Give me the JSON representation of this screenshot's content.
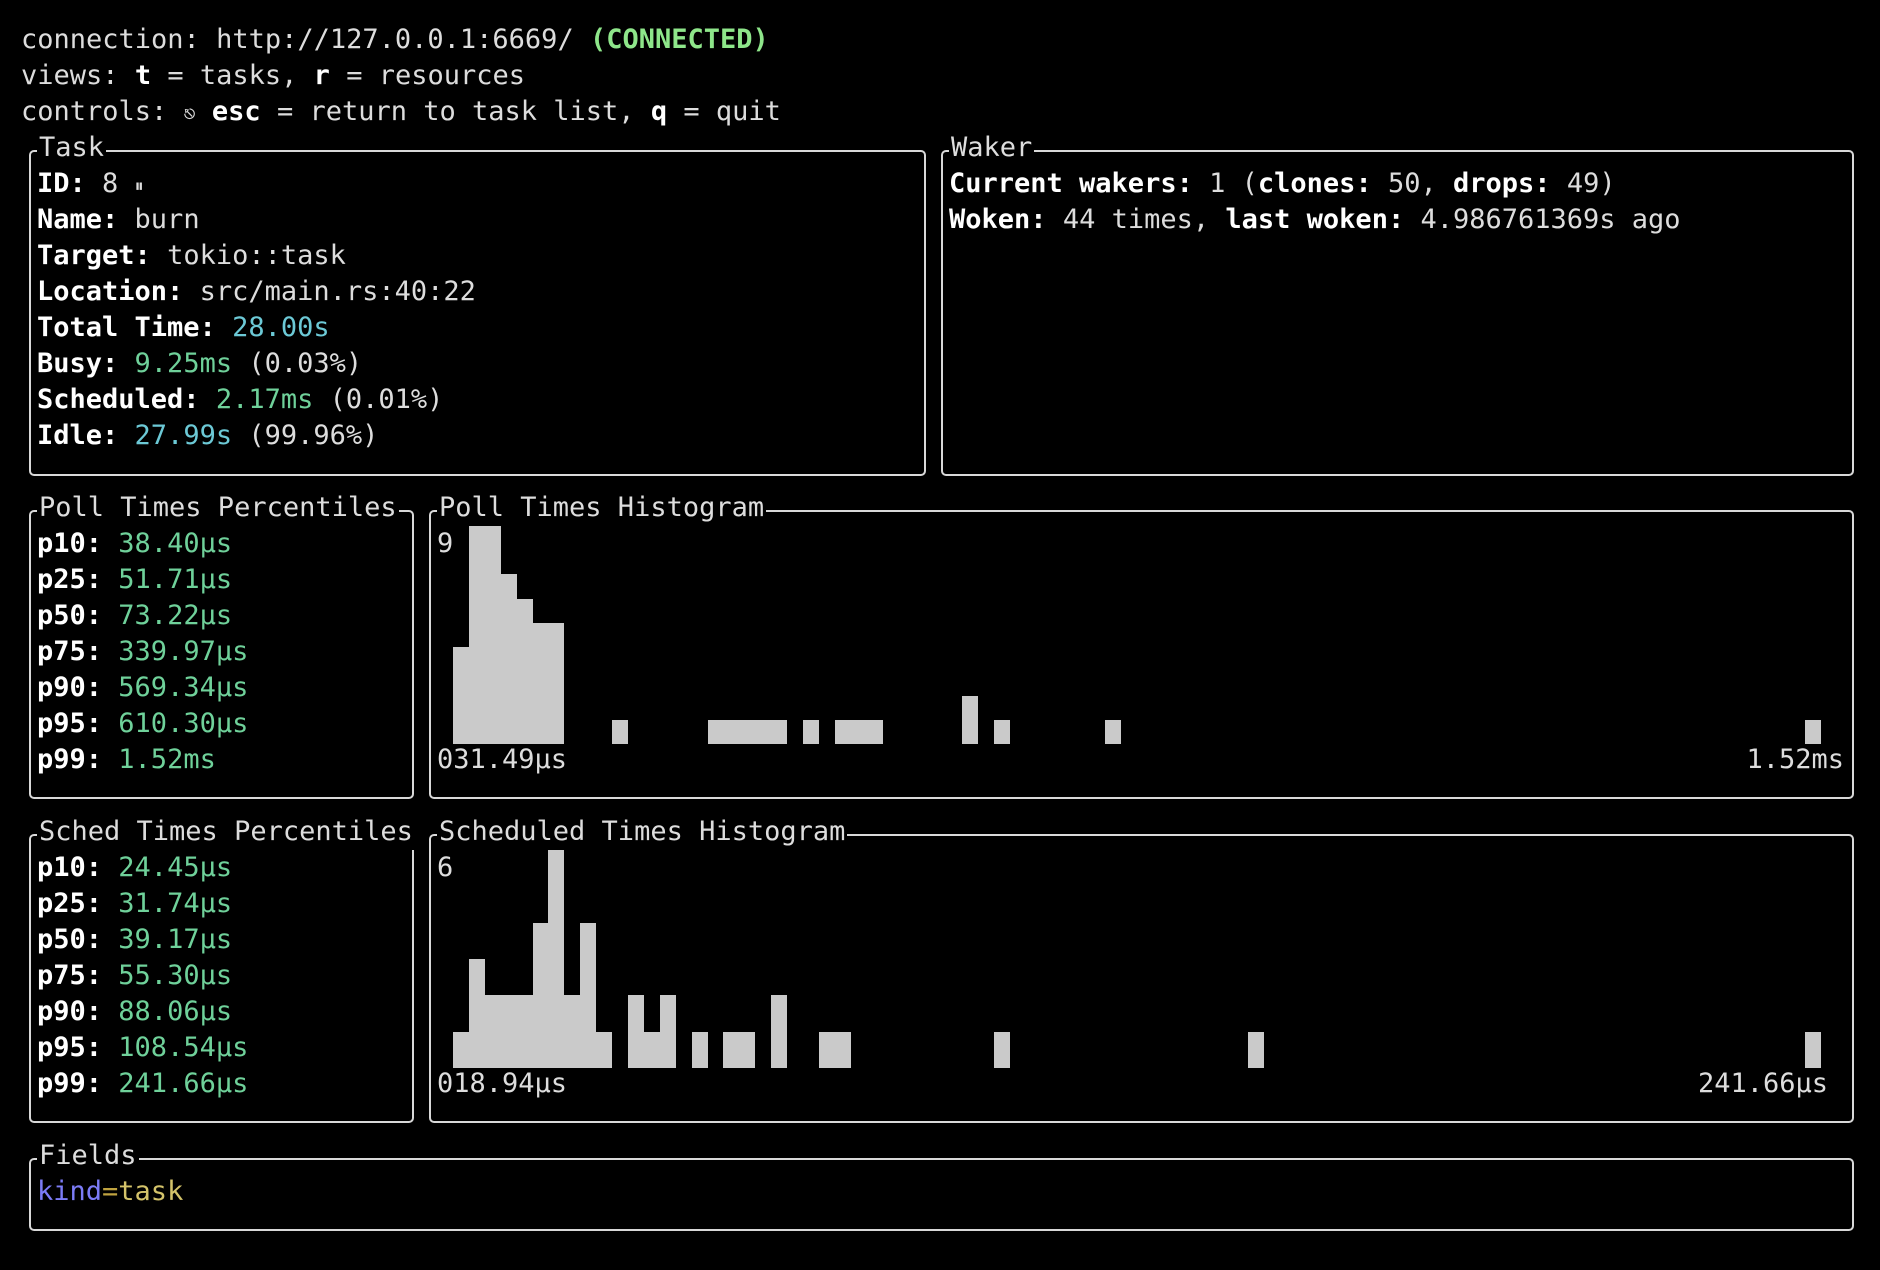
{
  "header": {
    "connection_label": "connection:",
    "connection_url": "http://127.0.0.1:6669/",
    "connection_status": "(CONNECTED)",
    "views_label": "views:",
    "views_t_key": "t",
    "views_t_text": "= tasks,",
    "views_r_key": "r",
    "views_r_text": "= resources",
    "controls_label": "controls:",
    "controls_icon": "⎋",
    "controls_esc_key": "esc",
    "controls_esc_text": "= return to task list,",
    "controls_q_key": "q",
    "controls_q_text": "= quit"
  },
  "task": {
    "title": "Task",
    "id_label": "ID:",
    "id_value": "8",
    "pause_icon": "⏸",
    "name_label": "Name:",
    "name_value": "burn",
    "target_label": "Target:",
    "target_value": "tokio::task",
    "location_label": "Location:",
    "location_value": "src/main.rs:40:22",
    "total_label": "Total Time:",
    "total_value": "28.00s",
    "busy_label": "Busy:",
    "busy_value": "9.25ms",
    "busy_pct": "(0.03%)",
    "scheduled_label": "Scheduled:",
    "scheduled_value": "2.17ms",
    "scheduled_pct": "(0.01%)",
    "idle_label": "Idle:",
    "idle_value": "27.99s",
    "idle_pct": "(99.96%)"
  },
  "waker": {
    "title": "Waker",
    "current_label": "Current wakers:",
    "current_value": "1",
    "clones_label": "clones:",
    "clones_value": "50,",
    "drops_label": "drops:",
    "drops_value": "49)",
    "open_paren": "(",
    "woken_label": "Woken:",
    "woken_text": "44 times,",
    "last_label": "last woken:",
    "last_value": "4.986761369s ago"
  },
  "poll_percentiles": {
    "title": "Poll Times Percentiles",
    "rows": [
      {
        "label": "p10:",
        "value": "38.40µs"
      },
      {
        "label": "p25:",
        "value": "51.71µs"
      },
      {
        "label": "p50:",
        "value": "73.22µs"
      },
      {
        "label": "p75:",
        "value": "339.97µs"
      },
      {
        "label": "p90:",
        "value": "569.34µs"
      },
      {
        "label": "p95:",
        "value": "610.30µs"
      },
      {
        "label": "p99:",
        "value": "1.52ms"
      }
    ]
  },
  "poll_histogram": {
    "title": "Poll Times Histogram",
    "max_label": "9",
    "min_x_label": "031.49µs",
    "max_x_label": "1.52ms",
    "max_count": 9,
    "bins": [
      4,
      9,
      9,
      7,
      6,
      5,
      5,
      0,
      0,
      0,
      1,
      0,
      0,
      0,
      0,
      0,
      1,
      1,
      1,
      1,
      1,
      0,
      1,
      0,
      1,
      1,
      1,
      0,
      0,
      0,
      0,
      0,
      2,
      0,
      1,
      0,
      0,
      0,
      0,
      0,
      0,
      1,
      0,
      0,
      0,
      0,
      0,
      0,
      0,
      0,
      0,
      0,
      0,
      0,
      0,
      0,
      0,
      0,
      0,
      0,
      0,
      0,
      0,
      0,
      0,
      0,
      0,
      0,
      0,
      0,
      0,
      0,
      0,
      0,
      0,
      0,
      0,
      0,
      0,
      0,
      0,
      0,
      0,
      0,
      0,
      1
    ]
  },
  "sched_percentiles": {
    "title": "Sched Times Percentiles",
    "rows": [
      {
        "label": "p10:",
        "value": "24.45µs"
      },
      {
        "label": "p25:",
        "value": "31.74µs"
      },
      {
        "label": "p50:",
        "value": "39.17µs"
      },
      {
        "label": "p75:",
        "value": "55.30µs"
      },
      {
        "label": "p90:",
        "value": "88.06µs"
      },
      {
        "label": "p95:",
        "value": "108.54µs"
      },
      {
        "label": "p99:",
        "value": "241.66µs"
      }
    ]
  },
  "sched_histogram": {
    "title": "Scheduled Times Histogram",
    "max_label": "6",
    "min_x_label": "018.94µs",
    "max_x_label": "241.66µs",
    "max_count": 6,
    "bins": [
      1,
      3,
      2,
      2,
      2,
      4,
      6,
      2,
      4,
      1,
      0,
      2,
      1,
      2,
      0,
      1,
      0,
      1,
      1,
      0,
      2,
      0,
      0,
      1,
      1,
      0,
      0,
      0,
      0,
      0,
      0,
      0,
      0,
      0,
      1,
      0,
      0,
      0,
      0,
      0,
      0,
      0,
      0,
      0,
      0,
      0,
      0,
      0,
      0,
      0,
      1,
      0,
      0,
      0,
      0,
      0,
      0,
      0,
      0,
      0,
      0,
      0,
      0,
      0,
      0,
      0,
      0,
      0,
      0,
      0,
      0,
      0,
      0,
      0,
      0,
      0,
      0,
      0,
      0,
      0,
      0,
      0,
      0,
      0,
      0,
      1
    ]
  },
  "fields": {
    "title": "Fields",
    "key": "kind",
    "eq": "=",
    "value": "task"
  },
  "colors": {
    "connected": "#8ee68a",
    "time_cyan": "#6cc9d6",
    "percentile_green": "#6fd19a",
    "field_key": "#7c7cf7",
    "field_value": "#d4c36a",
    "bar": "#cacaca"
  }
}
